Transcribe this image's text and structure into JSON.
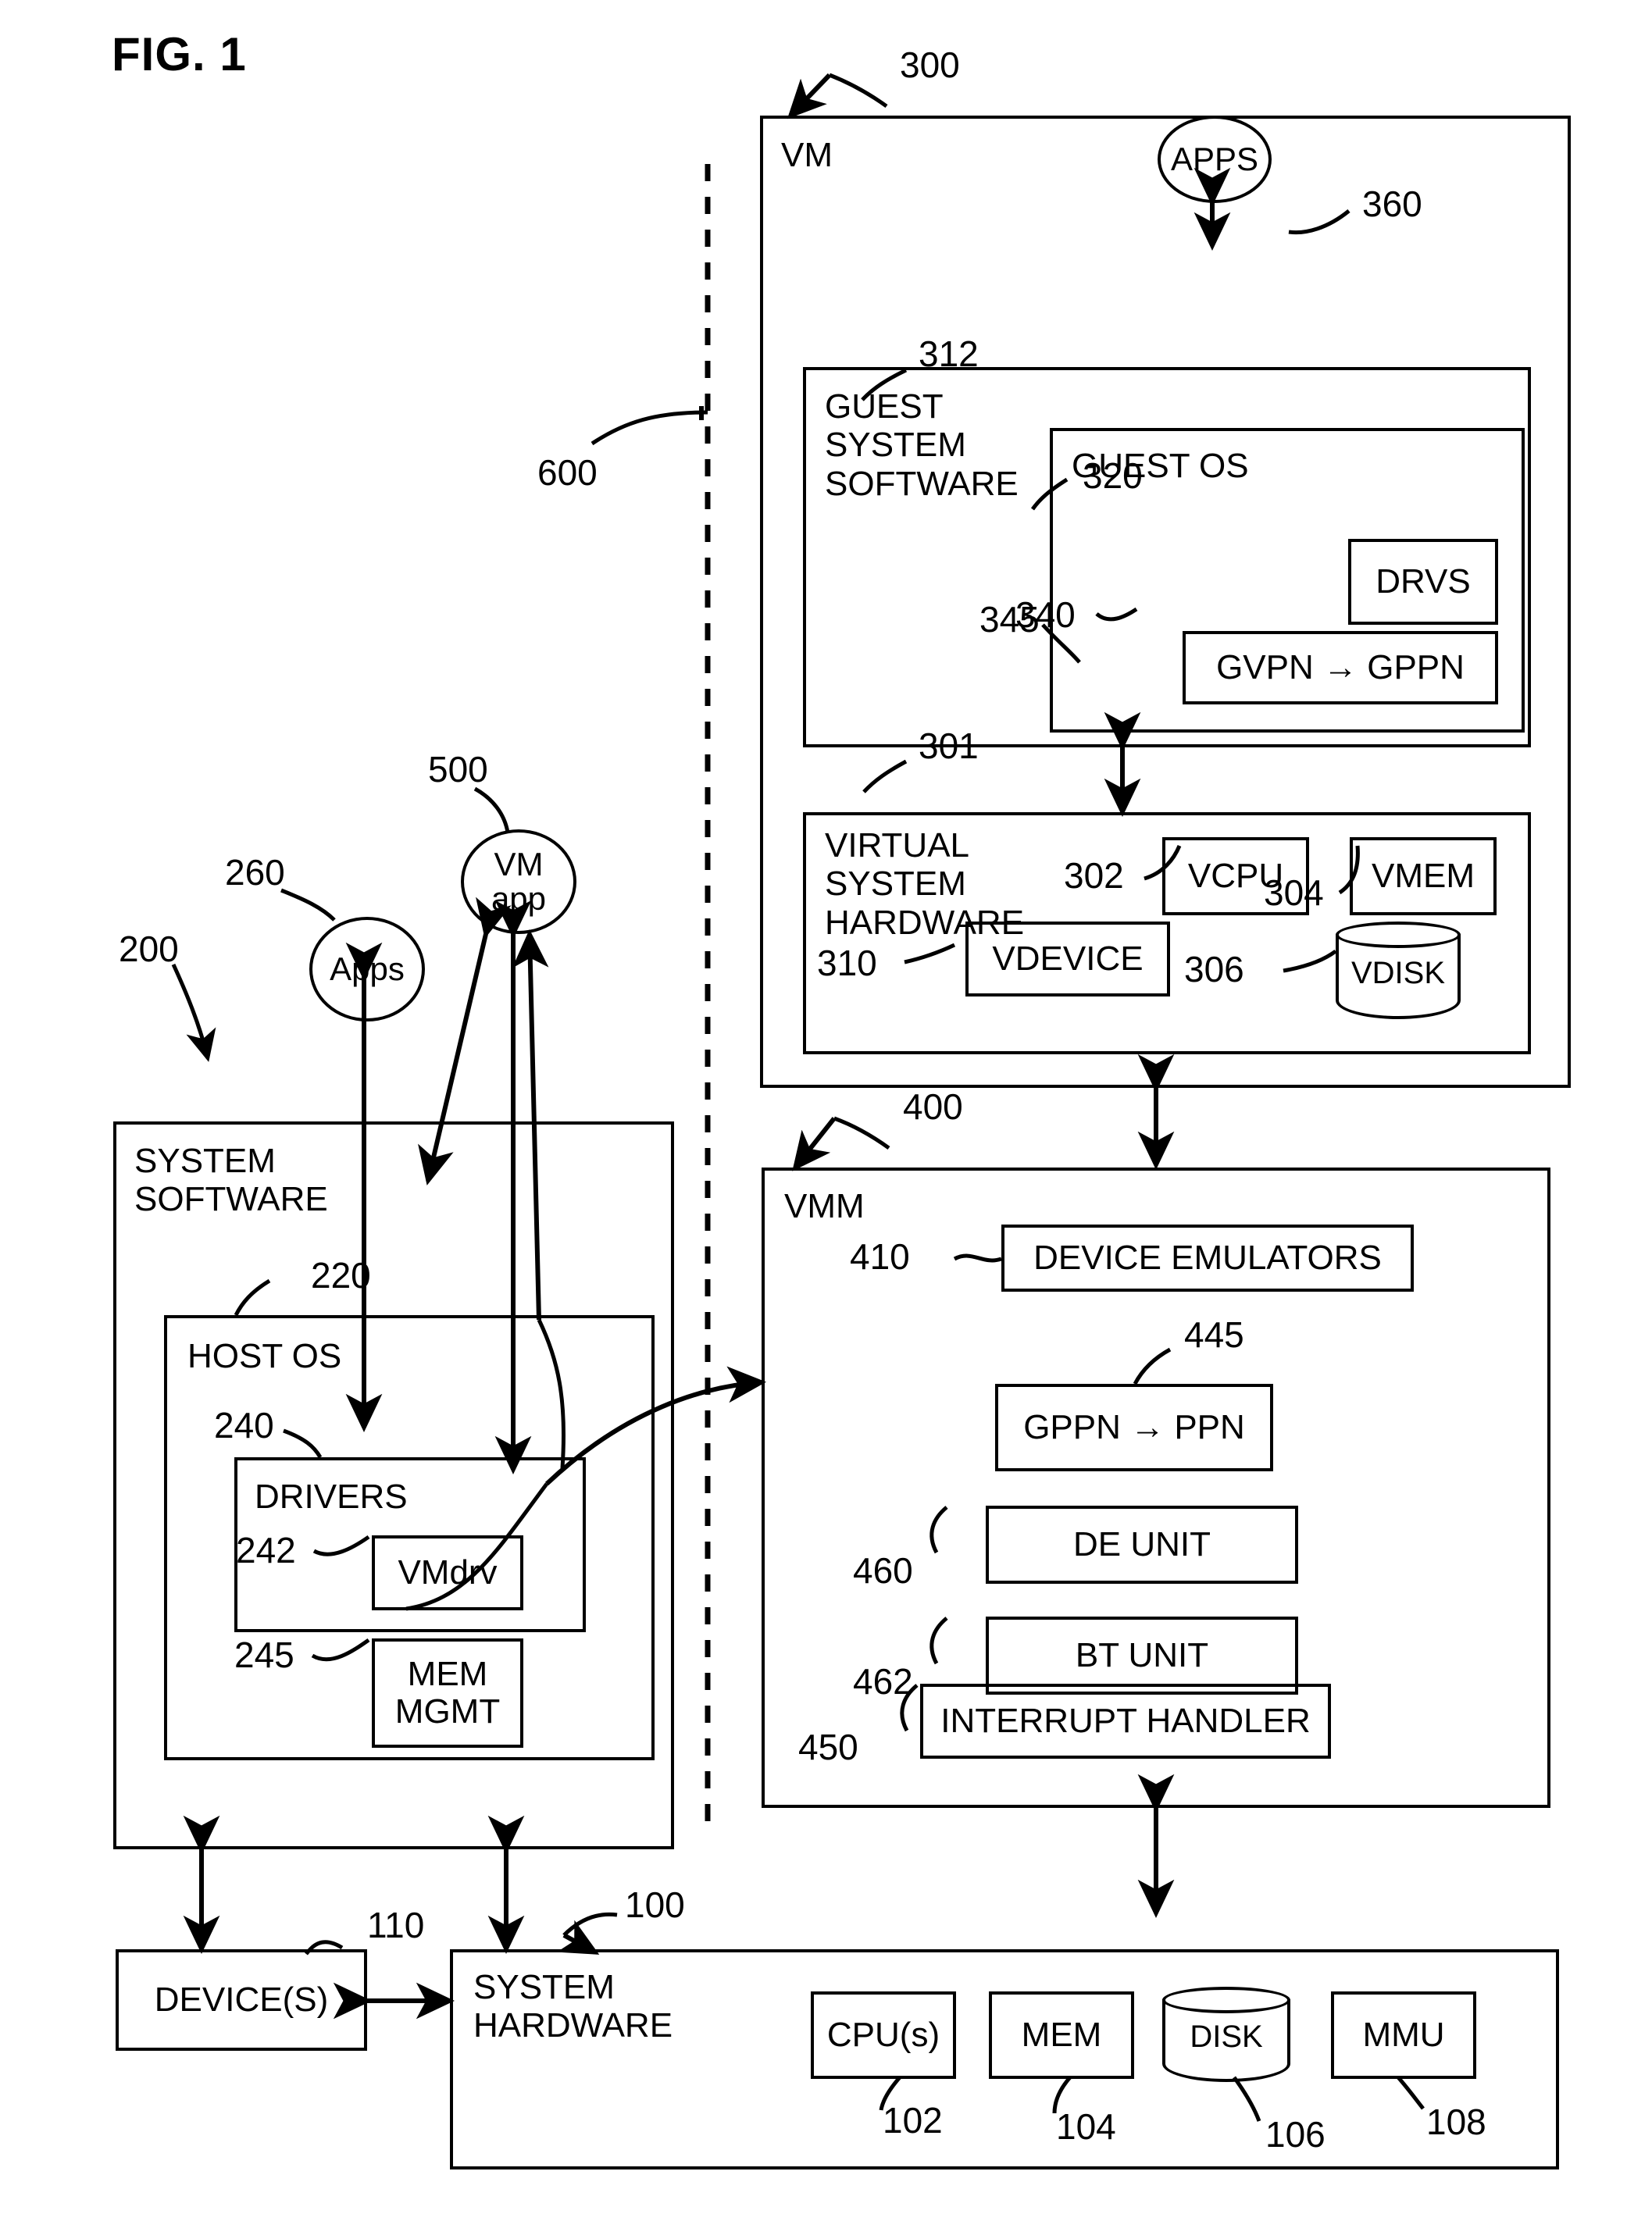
{
  "figure": {
    "title": "FIG. 1"
  },
  "refs": {
    "r100": "100",
    "r102": "102",
    "r104": "104",
    "r106": "106",
    "r108": "108",
    "r110": "110",
    "r200": "200",
    "r220": "220",
    "r240": "240",
    "r242": "242",
    "r245": "245",
    "r260": "260",
    "r300": "300",
    "r301": "301",
    "r302": "302",
    "r304": "304",
    "r306": "306",
    "r310": "310",
    "r312": "312",
    "r320": "320",
    "r340": "340",
    "r345": "345",
    "r360": "360",
    "r400": "400",
    "r410": "410",
    "r445": "445",
    "r450": "450",
    "r460": "460",
    "r462": "462",
    "r500": "500",
    "r600": "600"
  },
  "vm": {
    "title": "VM",
    "apps_bubble": "APPS",
    "guest_system_software": "GUEST\nSYSTEM\nSOFTWARE",
    "guest_os": "GUEST OS",
    "drvs": "DRVS",
    "gvpn_gppn": "GVPN → GPPN",
    "virtual_system_hardware": "VIRTUAL\nSYSTEM\nHARDWARE",
    "vcpu": "VCPU",
    "vmem": "VMEM",
    "vdisk": "VDISK",
    "vdevice": "VDEVICE"
  },
  "vmm": {
    "title": "VMM",
    "device_emulators": "DEVICE EMULATORS",
    "gppn_ppn": "GPPN → PPN",
    "de_unit": "DE UNIT",
    "bt_unit": "BT UNIT",
    "interrupt_handler": "INTERRUPT HANDLER"
  },
  "host": {
    "apps_bubble": "Apps",
    "vmapp_bubble": "VM\napp",
    "system_software": "SYSTEM\nSOFTWARE",
    "host_os": "HOST OS",
    "drivers": "DRIVERS",
    "vmdrv": "VMdrv",
    "mem_mgmt": "MEM\nMGMT"
  },
  "hardware": {
    "devices": "DEVICE(S)",
    "system_hardware": "SYSTEM\nHARDWARE",
    "cpus": "CPU(s)",
    "mem": "MEM",
    "disk": "DISK",
    "mmu": "MMU"
  },
  "colors": {
    "ink": "#000000",
    "paper": "#ffffff"
  }
}
